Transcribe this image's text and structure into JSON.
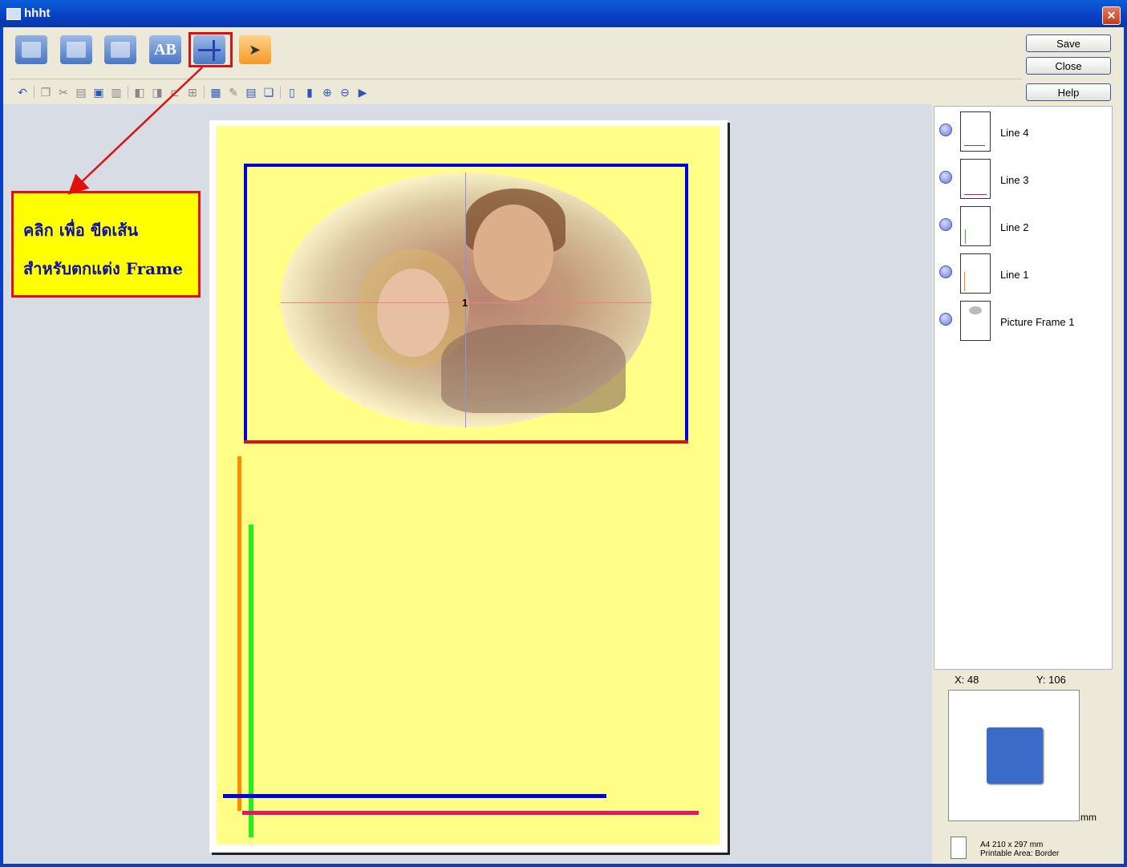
{
  "window": {
    "title": "hhht",
    "close_glyph": "✕"
  },
  "tools": [
    {
      "name": "picture-frame-tool-icon"
    },
    {
      "name": "photo-tool-icon"
    },
    {
      "name": "clipart-tool-icon"
    },
    {
      "name": "text-tool-icon",
      "label": "AB"
    },
    {
      "name": "line-tool-icon"
    },
    {
      "name": "select-tool-icon"
    }
  ],
  "buttons": {
    "save": "Save",
    "close": "Close",
    "help": "Help"
  },
  "toolbar2": [
    "undo-icon",
    "copy-icon",
    "cut-icon",
    "paste-icon",
    "select-all-icon",
    "delete-icon",
    "bring-front-icon",
    "send-back-icon",
    "align-icon",
    "group-icon",
    "grid-icon",
    "edit-icon",
    "properties-icon",
    "layer-icon",
    "page-icon",
    "page-fit-icon",
    "zoom-in-icon",
    "zoom-out-icon",
    "play-icon"
  ],
  "callout": {
    "line1": "คลิก เพื่อ ขีดเส้น",
    "line2": "สำหรับตกแต่ง Frame"
  },
  "canvas": {
    "frame_number": "1"
  },
  "layers": [
    {
      "label": "Line 4",
      "thumb_color": "#4444cc"
    },
    {
      "label": "Line 3",
      "thumb_color": "#ee1066"
    },
    {
      "label": "Line 2",
      "thumb_color": "#22cc22"
    },
    {
      "label": "Line 1",
      "thumb_color": "#ff8c00"
    },
    {
      "label": "Picture Frame 1",
      "thumb_color": "#888888"
    }
  ],
  "coords": {
    "x": "X: 48",
    "y": "Y: 106"
  },
  "units": "mm",
  "paper": {
    "size": "A4 210 x 297 mm",
    "printable": "Printable Area: Border"
  },
  "colors": {
    "accent": "#0a3fc4",
    "page_bg": "#ffff88",
    "highlight": "#e01010"
  }
}
